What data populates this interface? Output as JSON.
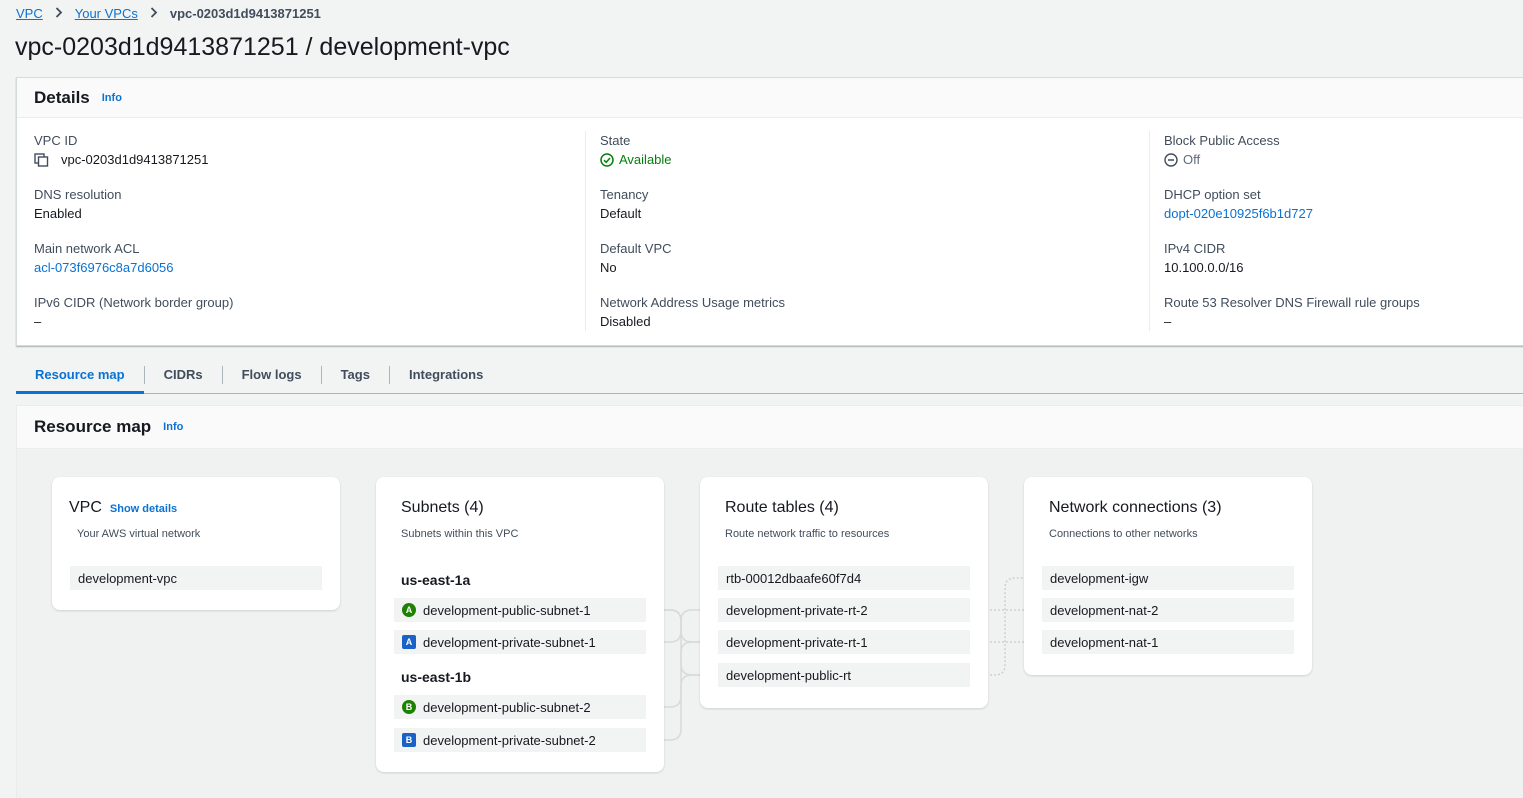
{
  "breadcrumb": {
    "items": [
      "VPC",
      "Your VPCs"
    ],
    "current": "vpc-0203d1d9413871251"
  },
  "page_title": "vpc-0203d1d9413871251 / development-vpc",
  "details": {
    "title": "Details",
    "info": "Info",
    "fields": {
      "vpc_id": {
        "label": "VPC ID",
        "value": "vpc-0203d1d9413871251"
      },
      "dns_resolution": {
        "label": "DNS resolution",
        "value": "Enabled"
      },
      "main_acl": {
        "label": "Main network ACL",
        "value": "acl-073f6976c8a7d6056"
      },
      "ipv6_cidr": {
        "label": "IPv6 CIDR (Network border group)",
        "value": "–"
      },
      "state": {
        "label": "State",
        "value": "Available"
      },
      "tenancy": {
        "label": "Tenancy",
        "value": "Default"
      },
      "default_vpc": {
        "label": "Default VPC",
        "value": "No"
      },
      "nau_metrics": {
        "label": "Network Address Usage metrics",
        "value": "Disabled"
      },
      "block_public": {
        "label": "Block Public Access",
        "value": "Off"
      },
      "dhcp": {
        "label": "DHCP option set",
        "value": "dopt-020e10925f6b1d727"
      },
      "ipv4_cidr": {
        "label": "IPv4 CIDR",
        "value": "10.100.0.0/16"
      },
      "r53": {
        "label": "Route 53 Resolver DNS Firewall rule groups",
        "value": "–"
      }
    }
  },
  "tabs": [
    "Resource map",
    "CIDRs",
    "Flow logs",
    "Tags",
    "Integrations"
  ],
  "resource_map": {
    "title": "Resource map",
    "info": "Info",
    "vpc_card": {
      "title": "VPC",
      "show_details": "Show details",
      "subtitle": "Your AWS virtual network",
      "item": "development-vpc"
    },
    "subnets_card": {
      "title": "Subnets (4)",
      "subtitle": "Subnets within this VPC",
      "az1": "us-east-1a",
      "az2": "us-east-1b",
      "items": [
        {
          "badge": "A",
          "name": "development-public-subnet-1"
        },
        {
          "badge": "A",
          "name": "development-private-subnet-1"
        },
        {
          "badge": "B",
          "name": "development-public-subnet-2"
        },
        {
          "badge": "B",
          "name": "development-private-subnet-2"
        }
      ]
    },
    "route_tables_card": {
      "title": "Route tables (4)",
      "subtitle": "Route network traffic to resources",
      "items": [
        "rtb-00012dbaafe60f7d4",
        "development-private-rt-2",
        "development-private-rt-1",
        "development-public-rt"
      ]
    },
    "network_card": {
      "title": "Network connections (3)",
      "subtitle": "Connections to other networks",
      "items": [
        "development-igw",
        "development-nat-2",
        "development-nat-1"
      ]
    }
  },
  "colors": {
    "link": "#0972d3",
    "success": "#037f0c",
    "public_badge": "#1d8102",
    "private_badge": "#1b62c7"
  }
}
